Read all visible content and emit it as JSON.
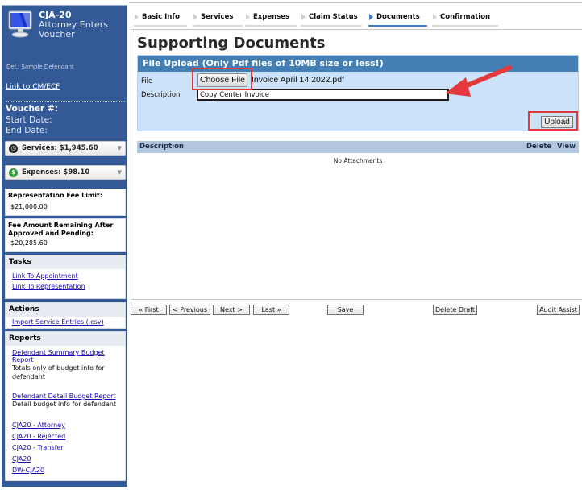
{
  "app": {
    "title": "CJA-20",
    "subtitle": "Attorney Enters Voucher",
    "defendant": "Def.: Sample Defendant",
    "cmecf_link": "Link to CM/ECF",
    "voucher_label": "Voucher #:",
    "start_date_label": "Start Date:",
    "end_date_label": "End Date:"
  },
  "sidebar": {
    "services": "Services: $1,945.60",
    "expenses": "Expenses: $98.10",
    "fee_limit": {
      "label": "Representation Fee Limit:",
      "value": "$21,000.00"
    },
    "fee_remaining": {
      "label": "Fee Amount Remaining After Approved and Pending:",
      "value": "$20,285.60"
    },
    "tasks": {
      "title": "Tasks",
      "items": [
        "Link To Appointment",
        "Link To Representation"
      ]
    },
    "actions": {
      "title": "Actions",
      "items": [
        "Import Service Entries (.csv)"
      ]
    },
    "reports": {
      "title": "Reports",
      "items": [
        {
          "label": "Defendant Summary Budget Report",
          "desc": "Totals only of budget info for defendant"
        },
        {
          "label": "Defendant Detail Budget Report",
          "desc": "Detail budget info for defendant"
        },
        {
          "label": "CJA20 - Attorney"
        },
        {
          "label": "CJA20 - Rejected"
        },
        {
          "label": "CJA20 - Transfer"
        },
        {
          "label": "CJA20"
        },
        {
          "label": "DW-CJA20"
        }
      ]
    }
  },
  "tabs": [
    {
      "label": "Basic Info",
      "active": false
    },
    {
      "label": "Services",
      "active": false
    },
    {
      "label": "Expenses",
      "active": false
    },
    {
      "label": "Claim Status",
      "active": false
    },
    {
      "label": "Documents",
      "active": true
    },
    {
      "label": "Confirmation",
      "active": false
    }
  ],
  "main": {
    "page_title": "Supporting Documents",
    "upload": {
      "header": "File Upload (Only Pdf files of 10MB size or less!)",
      "file_label": "File",
      "choose_button": "Choose File",
      "file_name": "Invoice April 14 2022.pdf",
      "description_label": "Description",
      "description_value": "Copy Center Invoice",
      "upload_button": "Upload"
    },
    "table": {
      "columns": [
        "Description",
        "Delete",
        "View"
      ],
      "empty_text": "No Attachments"
    },
    "buttons": {
      "first": "« First",
      "previous": "< Previous",
      "next": "Next >",
      "last": "Last »",
      "save": "Save",
      "delete_draft": "Delete Draft",
      "audit_assist": "Audit Assist"
    }
  },
  "colors": {
    "sidebar_bg": "#335a96",
    "upload_header": "#437fb5",
    "upload_panel": "#cce2f8",
    "table_header": "#b2c6e0",
    "active_tab": "#3a80c9",
    "annotation": "#e4393c"
  }
}
